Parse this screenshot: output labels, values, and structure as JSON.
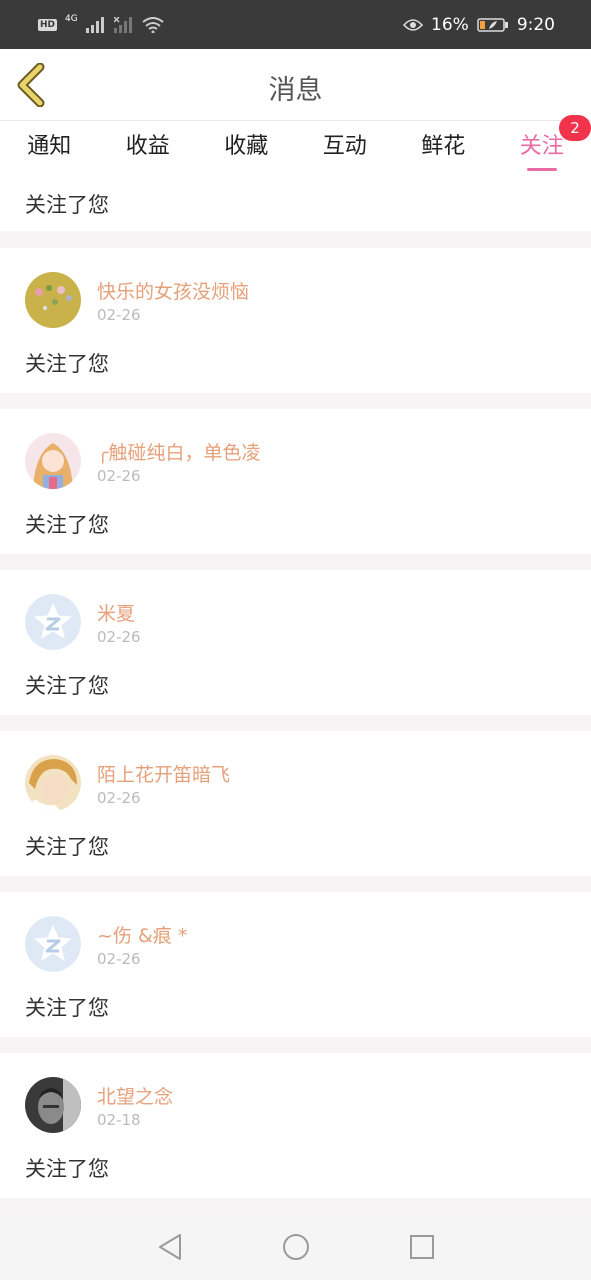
{
  "status_bar": {
    "hd": "HD",
    "network": "4G",
    "battery_percent": "16%",
    "time": "9:20"
  },
  "header": {
    "title": "消息",
    "back_icon": "chevron-left-icon"
  },
  "tabs": [
    {
      "label": "通知",
      "active": false
    },
    {
      "label": "收益",
      "active": false
    },
    {
      "label": "收藏",
      "active": false
    },
    {
      "label": "互动",
      "active": false
    },
    {
      "label": "鲜花",
      "active": false
    },
    {
      "label": "关注",
      "active": true,
      "badge": "2"
    }
  ],
  "partial_item": {
    "action": "关注了您"
  },
  "notifications": [
    {
      "name": "快乐的女孩没烦恼",
      "date": "02-26",
      "action": "关注了您"
    },
    {
      "name": "╭触碰纯白，单色凌",
      "date": "02-26",
      "action": "关注了您"
    },
    {
      "name": "米夏",
      "date": "02-26",
      "action": "关注了您"
    },
    {
      "name": "陌上花开笛暗飞",
      "date": "02-26",
      "action": "关注了您"
    },
    {
      "name": "~伤 &痕 *",
      "date": "02-26",
      "action": "关注了您"
    },
    {
      "name": "北望之念",
      "date": "02-18",
      "action": "关注了您"
    }
  ],
  "colors": {
    "accent": "#ea6aa3",
    "badge": "#f2334c",
    "username": "#e6a07a"
  }
}
